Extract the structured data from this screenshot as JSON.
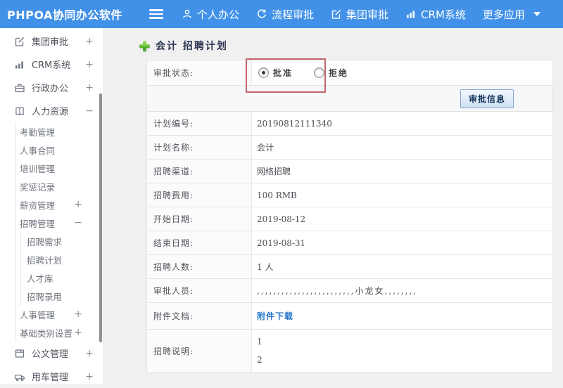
{
  "app": {
    "logo": "PHPOA协同办公软件"
  },
  "header": {
    "nav": [
      {
        "label": "个人办公",
        "icon": "user-icon"
      },
      {
        "label": "流程审批",
        "icon": "process-icon"
      },
      {
        "label": "集团审批",
        "icon": "edit-icon"
      },
      {
        "label": "CRM系统",
        "icon": "chart-icon"
      },
      {
        "label": "更多应用",
        "icon": "caret-down-icon"
      }
    ]
  },
  "sidebar": {
    "items": [
      {
        "label": "集团审批",
        "expand": "+"
      },
      {
        "label": "CRM系统",
        "expand": "+"
      },
      {
        "label": "行政办公",
        "expand": "+"
      },
      {
        "label": "人力资源",
        "expand": "−"
      },
      {
        "label": "考勤管理",
        "expand": ""
      },
      {
        "label": "人事合同",
        "expand": ""
      },
      {
        "label": "培训管理",
        "expand": ""
      },
      {
        "label": "奖惩记录",
        "expand": ""
      },
      {
        "label": "薪资管理",
        "expand": "+"
      },
      {
        "label": "招聘管理",
        "expand": "−"
      },
      {
        "label": "招聘需求",
        "expand": ""
      },
      {
        "label": "招聘计划",
        "expand": ""
      },
      {
        "label": "人才库",
        "expand": ""
      },
      {
        "label": "招聘录用",
        "expand": ""
      },
      {
        "label": "人事管理",
        "expand": "+"
      },
      {
        "label": "基础类别设置",
        "expand": "+"
      },
      {
        "label": "公文管理",
        "expand": "+"
      },
      {
        "label": "用车管理",
        "expand": "+"
      }
    ]
  },
  "page": {
    "title": "会计 招聘计划"
  },
  "form": {
    "status": {
      "label": "审批状态:",
      "options": [
        {
          "label": "批准",
          "selected": true
        },
        {
          "label": "拒绝",
          "selected": false
        }
      ]
    },
    "approval_info_button": "审批信息",
    "fields": [
      {
        "label": "计划编号:",
        "value": "20190812111340"
      },
      {
        "label": "计划名称:",
        "value": "会计"
      },
      {
        "label": "招聘渠道:",
        "value": "网络招聘"
      },
      {
        "label": "招聘费用:",
        "value": "100 RMB"
      },
      {
        "label": "开始日期:",
        "value": "2019-08-12"
      },
      {
        "label": "结束日期:",
        "value": "2019-08-31"
      },
      {
        "label": "招聘人数:",
        "value": "1 人"
      },
      {
        "label": "审批人员:",
        "value": ",,,,,,,,,,,,,,,,,,,,,,,,小龙女,,,,,,,,"
      }
    ],
    "attachment": {
      "label": "附件文档:",
      "link_text": "附件下载"
    },
    "description": {
      "label": "招聘说明:",
      "lines": [
        "1",
        "2"
      ]
    }
  },
  "colors": {
    "header_bg": "#4291e8",
    "annotation_red": "#c4666b",
    "link_blue": "#2878c8",
    "button_face": "#cfe0f4"
  }
}
